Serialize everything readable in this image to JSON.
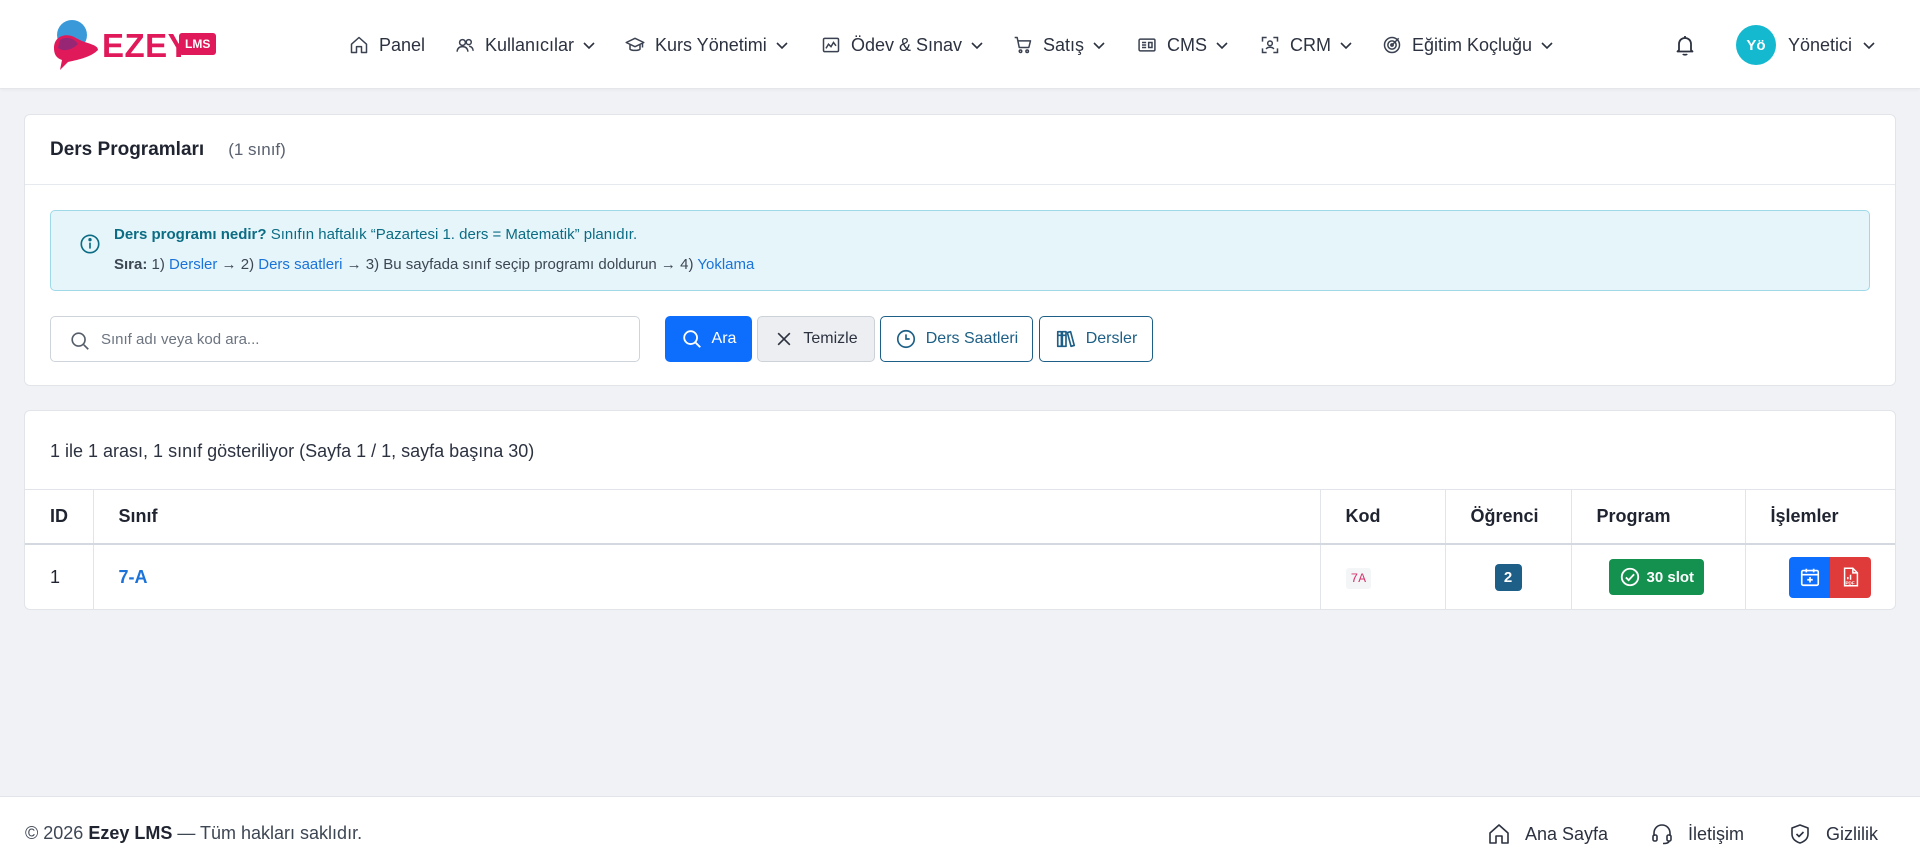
{
  "brand": {
    "name": "EZEY",
    "badge": "LMS"
  },
  "nav": {
    "items": [
      {
        "label": "Panel",
        "icon": "home-icon"
      },
      {
        "label": "Kullanıcılar",
        "icon": "users-icon"
      },
      {
        "label": "Kurs Yönetimi",
        "icon": "graduation-cap-icon"
      },
      {
        "label": "Ödev & Sınav",
        "icon": "exam-icon"
      },
      {
        "label": "Satış",
        "icon": "cart-icon"
      },
      {
        "label": "CMS",
        "icon": "cms-icon"
      },
      {
        "label": "CRM",
        "icon": "crm-icon"
      },
      {
        "label": "Eğitim Koçluğu",
        "icon": "target-icon"
      }
    ],
    "user": {
      "initials": "Yö",
      "name": "Yönetici"
    }
  },
  "page": {
    "title": "Ders Programları",
    "count": "(1 sınıf)"
  },
  "info": {
    "q_bold": "Ders programı nedir?",
    "q_text": " Sınıfın haftalık “Pazartesi 1. ders = Matematik” planıdır.",
    "order_bold": "Sıra:",
    "step1_pre": " 1) ",
    "step1_link": "Dersler",
    "step2_pre": " → 2) ",
    "step2_link": "Ders saatleri",
    "step3": " → 3) Bu sayfada sınıf seçip programı doldurun → 4) ",
    "step4_link": "Yoklama"
  },
  "search": {
    "placeholder": "Sınıf adı veya kod ara...",
    "value": ""
  },
  "buttons": {
    "search": "Ara",
    "clear": "Temizle",
    "hours": "Ders Saatleri",
    "lessons": "Dersler"
  },
  "table": {
    "summary": "1 ile 1 arası, 1 sınıf gösteriliyor (Sayfa 1 / 1, sayfa başına 30)",
    "headers": {
      "id": "ID",
      "sinif": "Sınıf",
      "kod": "Kod",
      "ogrenci": "Öğrenci",
      "program": "Program",
      "islemler": "İşlemler"
    },
    "rows": [
      {
        "id": "1",
        "sinif": "7-A",
        "kod": "7A",
        "ogrenci": "2",
        "program": "30 slot"
      }
    ]
  },
  "footer": {
    "copy_pre": "© 2026 ",
    "copy_brand": "Ezey LMS",
    "copy_post": " — Tüm hakları saklıdır.",
    "links": {
      "home": "Ana Sayfa",
      "contact": "İletişim",
      "privacy": "Gizlilik"
    }
  },
  "colors": {
    "brand": "#e0195b",
    "primary": "#0d6efd",
    "success": "#14904f",
    "danger": "#e03b3b",
    "info_bg": "#e6f5fa"
  }
}
